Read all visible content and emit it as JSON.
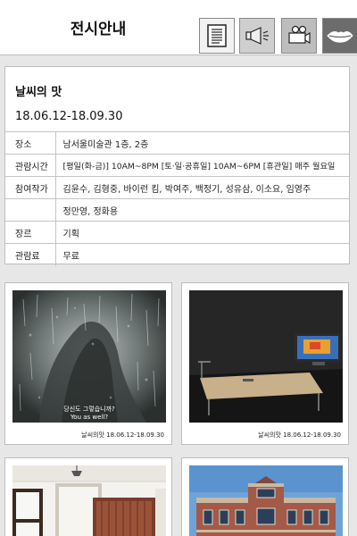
{
  "header": {
    "title": "전시안내",
    "buttons": [
      {
        "name": "text-guide-button",
        "icon": "document-icon"
      },
      {
        "name": "audio-guide-button",
        "icon": "megaphone-icon"
      },
      {
        "name": "video-guide-button",
        "icon": "video-camera-icon"
      },
      {
        "name": "sign-language-button",
        "icon": "lips-icon"
      }
    ]
  },
  "exhibition": {
    "title": "날씨의 맛",
    "period": "18.06.12-18.09.30",
    "rows": [
      {
        "label": "장소",
        "value": "남서울미술관 1층, 2층"
      },
      {
        "label": "관람시간",
        "value": "[평일(화-금)] 10AM~8PM [토·일·공휴일] 10AM~6PM [휴관일] 매주 월요일"
      },
      {
        "label": "참여작가",
        "value": "김윤수, 김형중, 바이런 킴, 박여주, 백정기, 성유삼, 이소요, 임영주"
      },
      {
        "label": "",
        "value": "정만영, 정화용"
      },
      {
        "label": "장르",
        "value": "기획"
      },
      {
        "label": "관람료",
        "value": "무료"
      }
    ]
  },
  "gallery": {
    "items": [
      {
        "caption": "날씨의맛 18.06.12-18.09.30",
        "overlay_line1": "당신도 그렇습니까?",
        "overlay_line2": "You as well?"
      },
      {
        "caption": "날씨의맛 18.06.12-18.09.30"
      },
      {
        "caption": ""
      },
      {
        "caption": ""
      }
    ]
  },
  "colors": {
    "page_background": "#e7e7e7",
    "active_button": "#6c6c6c"
  }
}
